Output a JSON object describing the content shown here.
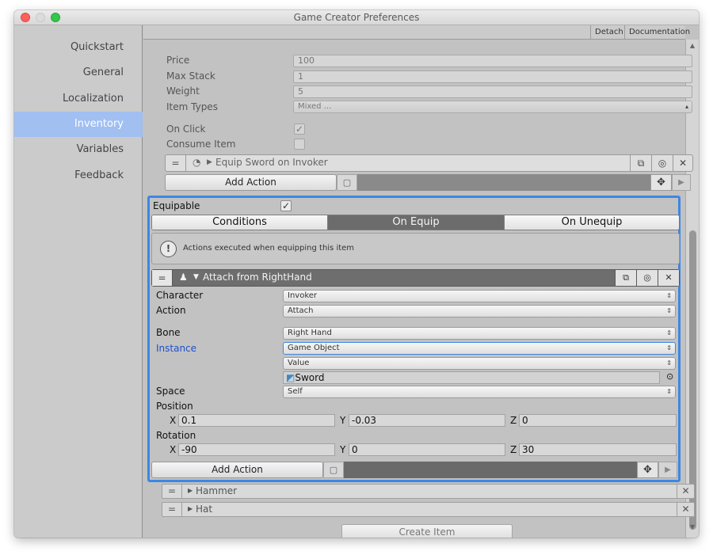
{
  "window": {
    "title": "Game Creator Preferences"
  },
  "sidebar": {
    "items": [
      {
        "label": "Quickstart"
      },
      {
        "label": "General"
      },
      {
        "label": "Localization"
      },
      {
        "label": "Inventory"
      },
      {
        "label": "Variables"
      },
      {
        "label": "Feedback"
      }
    ],
    "active_index": 3
  },
  "topbar": {
    "detach_label": "Detach",
    "documentation_label": "Documentation"
  },
  "item": {
    "price_label": "Price",
    "price_value": "100",
    "max_stack_label": "Max Stack",
    "max_stack_value": "1",
    "weight_label": "Weight",
    "weight_value": "5",
    "item_types_label": "Item Types",
    "item_types_value": "Mixed ...",
    "on_click_label": "On Click",
    "on_click_checked": true,
    "consume_item_label": "Consume Item",
    "consume_item_checked": false
  },
  "click_actions": {
    "action_title": "Equip Sword on Invoker",
    "add_action_label": "Add Action"
  },
  "equipable": {
    "label": "Equipable",
    "checked": true,
    "tabs": [
      {
        "label": "Conditions"
      },
      {
        "label": "On Equip"
      },
      {
        "label": "On Unequip"
      }
    ],
    "active_tab": 1,
    "help_text": "Actions executed when equipping this item",
    "action_title": "Attach from RightHand",
    "fields": {
      "character_label": "Character",
      "character_value": "Invoker",
      "action_label": "Action",
      "action_value": "Attach",
      "bone_label": "Bone",
      "bone_value": "Right Hand",
      "instance_label": "Instance",
      "instance_value": "Game Object",
      "value_value": "Value",
      "object_value": "Sword",
      "space_label": "Space",
      "space_value": "Self",
      "position_label": "Position",
      "position": {
        "x": "0.1",
        "y": "-0.03",
        "z": "0"
      },
      "rotation_label": "Rotation",
      "rotation": {
        "x": "-90",
        "y": "0",
        "z": "30"
      }
    },
    "add_action_label": "Add Action"
  },
  "axis_labels": {
    "x": "X",
    "y": "Y",
    "z": "Z"
  },
  "items_list": [
    {
      "name": "Hammer"
    },
    {
      "name": "Hat"
    }
  ],
  "create_item_label": "Create Item",
  "colors": {
    "selection_blue": "#3d87e3",
    "sidebar_active": "#a1bff1",
    "instance_label": "#1f4fcc"
  }
}
